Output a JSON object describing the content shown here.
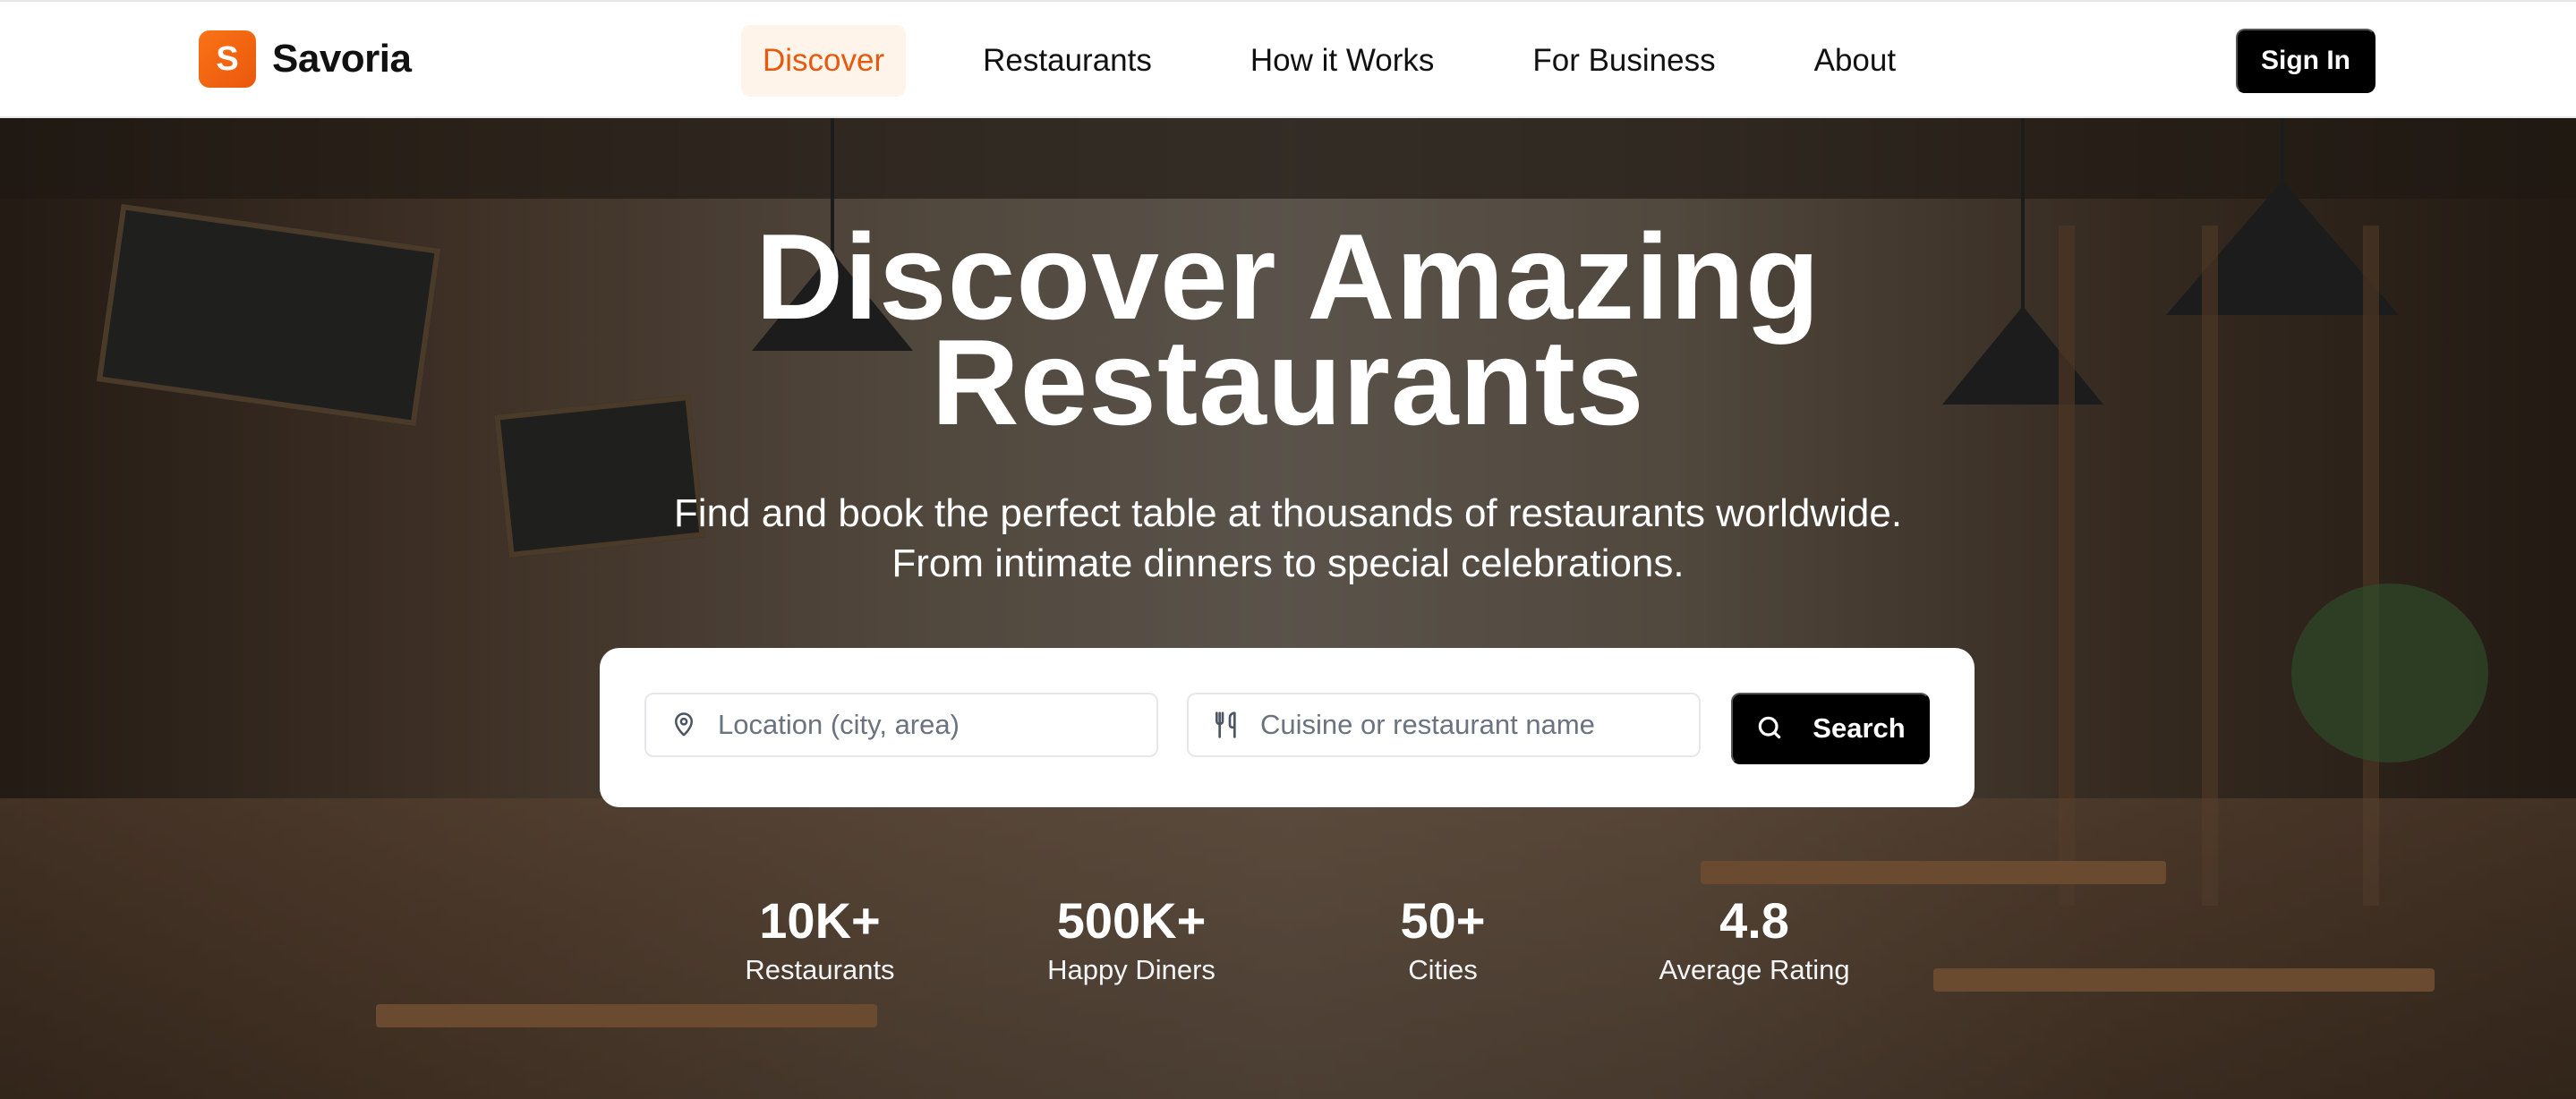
{
  "brand": {
    "logo_letter": "S",
    "name": "Savoria",
    "accent": "#ea580c"
  },
  "nav": {
    "links": [
      {
        "label": "Discover",
        "active": true
      },
      {
        "label": "Restaurants",
        "active": false
      },
      {
        "label": "How it Works",
        "active": false
      },
      {
        "label": "For Business",
        "active": false
      },
      {
        "label": "About",
        "active": false
      }
    ],
    "sign_in": "Sign In"
  },
  "hero": {
    "title_line1": "Discover Amazing",
    "title_line2": "Restaurants",
    "subtitle_line1": "Find and book the perfect table at thousands of restaurants worldwide.",
    "subtitle_line2": "From intimate dinners to special celebrations."
  },
  "search": {
    "location_placeholder": "Location (city, area)",
    "location_value": "",
    "location_icon": "map-pin-icon",
    "cuisine_placeholder": "Cuisine or restaurant name",
    "cuisine_value": "",
    "cuisine_icon": "utensils-icon",
    "button_label": "Search",
    "button_icon": "search-icon"
  },
  "stats": [
    {
      "value": "10K+",
      "label": "Restaurants"
    },
    {
      "value": "500K+",
      "label": "Happy Diners"
    },
    {
      "value": "50+",
      "label": "Cities"
    },
    {
      "value": "4.8",
      "label": "Average Rating"
    }
  ]
}
